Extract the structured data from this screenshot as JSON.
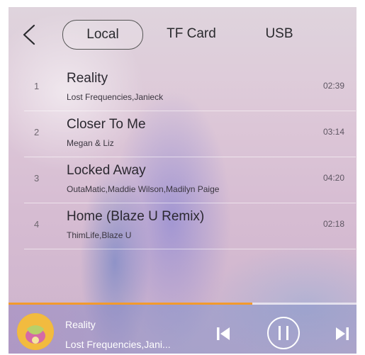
{
  "header": {
    "tabs": [
      {
        "label": "Local",
        "active": true
      },
      {
        "label": "TF Card",
        "active": false
      },
      {
        "label": "USB",
        "active": false
      }
    ]
  },
  "tracks": [
    {
      "number": "1",
      "title": "Reality",
      "artist": "Lost Frequencies,Janieck",
      "duration": "02:39"
    },
    {
      "number": "2",
      "title": "Closer To Me",
      "artist": "Megan & Liz",
      "duration": "03:14"
    },
    {
      "number": "3",
      "title": "Locked Away",
      "artist": "OutaMatic,Maddie Wilson,Madilyn Paige",
      "duration": "04:20"
    },
    {
      "number": "4",
      "title": "Home (Blaze U Remix)",
      "artist": "ThimLife,Blaze U",
      "duration": "02:18"
    }
  ],
  "now_playing": {
    "title": "Reality",
    "artist": "Lost Frequencies,Jani...",
    "progress": 0.7
  },
  "colors": {
    "progress": "#f39a2c",
    "controls": "#ffffff"
  },
  "icons": {
    "back": "chevron-left-icon",
    "prev": "skip-previous-icon",
    "pause": "pause-circle-icon",
    "next": "skip-next-icon"
  }
}
